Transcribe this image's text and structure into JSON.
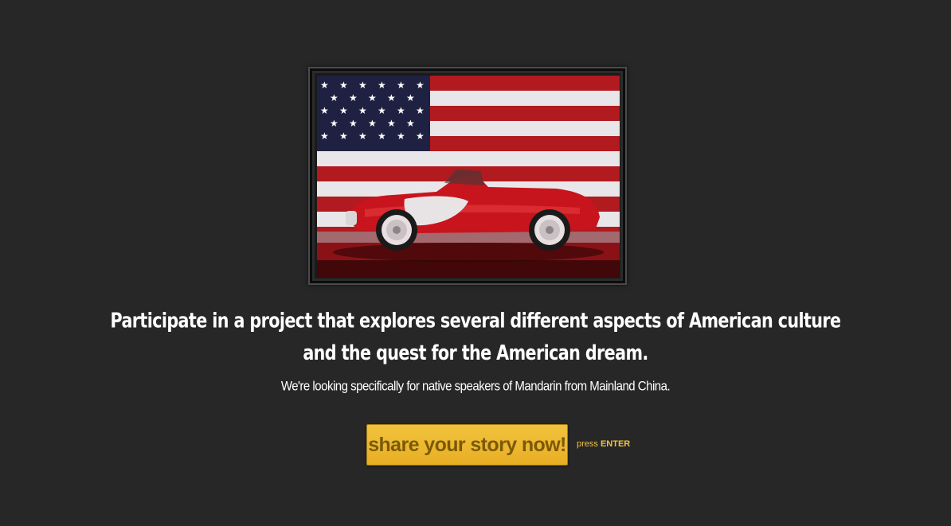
{
  "image": {
    "alt_icon": "red-convertible-flag-photo"
  },
  "headline": {
    "line1": "Participate in a project that explores several different aspects of American culture",
    "line2": "and the quest for the American dream."
  },
  "subline": "We're looking specifically for native speakers of Mandarin from Mainland China.",
  "cta": {
    "label": "share your story now!",
    "hint_prefix": "press",
    "hint_key": "ENTER"
  },
  "colors": {
    "background": "#272727",
    "accent": "#f2c33d",
    "button_text": "#7a5a06"
  }
}
